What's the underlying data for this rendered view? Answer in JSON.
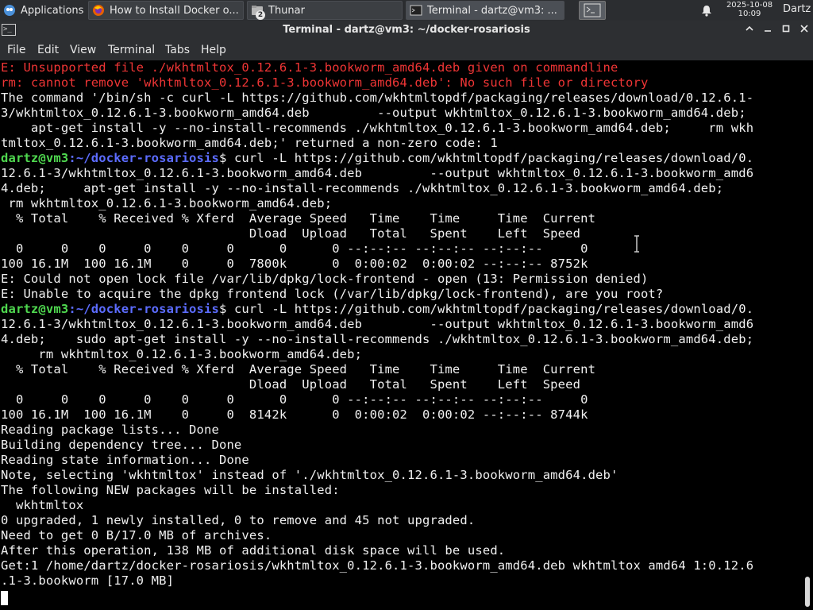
{
  "taskbar": {
    "apps_menu": "Applications",
    "tasks": [
      {
        "label": "How to Install Docker o..."
      },
      {
        "label": "Thunar",
        "badge": "2"
      },
      {
        "label": "Terminal - dartz@vm3: ..."
      }
    ],
    "clock_date": "2025-10-08",
    "clock_time": "10:09",
    "user": "Dartz"
  },
  "window": {
    "title": "Terminal - dartz@vm3: ~/docker-rosariosis",
    "icon_text": ">_",
    "controls": [
      "^",
      "_",
      "□",
      "X"
    ]
  },
  "menu": {
    "file": "File",
    "edit": "Edit",
    "view": "View",
    "terminal": "Terminal",
    "tabs": "Tabs",
    "help": "Help"
  },
  "prompt": {
    "user_host": "dartz@vm3",
    "path": ":~/docker-rosariosis",
    "symbol": "$"
  },
  "terminal": {
    "lines": [
      "E: Unsupported file ./wkhtmltox_0.12.6.1-3.bookworm_amd64.deb given on commandline",
      "rm: cannot remove 'wkhtmltox_0.12.6.1-3.bookworm_amd64.deb': No such file or directory",
      "The command '/bin/sh -c curl -L https://github.com/wkhtmltopdf/packaging/releases/download/0.12.6.1-",
      "3/wkhtmltox_0.12.6.1-3.bookworm_amd64.deb         --output wkhtmltox_0.12.6.1-3.bookworm_amd64.deb;",
      "    apt-get install -y --no-install-recommends ./wkhtmltox_0.12.6.1-3.bookworm_amd64.deb;     rm wkh",
      "tmltox_0.12.6.1-3.bookworm_amd64.deb;' returned a non-zero code: 1",
      " curl -L https://github.com/wkhtmltopdf/packaging/releases/download/0.",
      "12.6.1-3/wkhtmltox_0.12.6.1-3.bookworm_amd64.deb         --output wkhtmltox_0.12.6.1-3.bookworm_amd6",
      "4.deb;     apt-get install -y --no-install-recommends ./wkhtmltox_0.12.6.1-3.bookworm_amd64.deb;",
      " rm wkhtmltox_0.12.6.1-3.bookworm_amd64.deb;",
      "  % Total    % Received % Xferd  Average Speed   Time    Time     Time  Current",
      "                                 Dload  Upload   Total   Spent    Left  Speed",
      "  0     0    0     0    0     0      0      0 --:--:-- --:--:-- --:--:--     0",
      "100 16.1M  100 16.1M    0     0  7800k      0  0:00:02  0:00:02 --:--:-- 8752k",
      "E: Could not open lock file /var/lib/dpkg/lock-frontend - open (13: Permission denied)",
      "E: Unable to acquire the dpkg frontend lock (/var/lib/dpkg/lock-frontend), are you root?",
      " curl -L https://github.com/wkhtmltopdf/packaging/releases/download/0.",
      "12.6.1-3/wkhtmltox_0.12.6.1-3.bookworm_amd64.deb         --output wkhtmltox_0.12.6.1-3.bookworm_amd6",
      "4.deb;    sudo apt-get install -y --no-install-recommends ./wkhtmltox_0.12.6.1-3.bookworm_amd64.deb;",
      "     rm wkhtmltox_0.12.6.1-3.bookworm_amd64.deb;",
      "  % Total    % Received % Xferd  Average Speed   Time    Time     Time  Current",
      "                                 Dload  Upload   Total   Spent    Left  Speed",
      "  0     0    0     0    0     0      0      0 --:--:-- --:--:-- --:--:--     0",
      "100 16.1M  100 16.1M    0     0  8142k      0  0:00:02  0:00:02 --:--:-- 8744k",
      "Reading package lists... Done",
      "Building dependency tree... Done",
      "Reading state information... Done",
      "Note, selecting 'wkhtmltox' instead of './wkhtmltox_0.12.6.1-3.bookworm_amd64.deb'",
      "The following NEW packages will be installed:",
      "  wkhtmltox",
      "0 upgraded, 1 newly installed, 0 to remove and 45 not upgraded.",
      "Need to get 0 B/17.0 MB of archives.",
      "After this operation, 138 MB of additional disk space will be used.",
      "Get:1 /home/dartz/docker-rosariosis/wkhtmltox_0.12.6.1-3.bookworm_amd64.deb wkhtmltox amd64 1:0.12.6",
      ".1-3.bookworm [17.0 MB]"
    ]
  },
  "colors": {
    "error": "#ef3535",
    "prompt_user": "#4fd84f",
    "prompt_path": "#5c6cff",
    "text": "#f0f0f0",
    "background": "#000000"
  }
}
